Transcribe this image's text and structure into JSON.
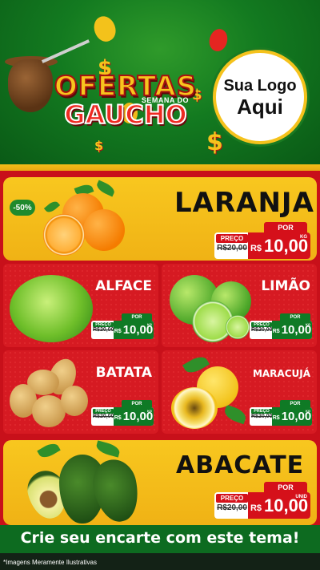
{
  "header": {
    "title_line1": "OFERTAS",
    "title_small": "SEMANA DO",
    "title_line2": "GAUCHO",
    "logo_line1": "Sua Logo",
    "logo_line2": "Aqui"
  },
  "featured_top": {
    "discount": "-50%",
    "name": "LARANJA",
    "por_label": "POR",
    "preco_label": "PREÇO",
    "old_price": "R$20,00",
    "currency": "R$",
    "price": "10,00",
    "unit": "KG"
  },
  "grid": [
    {
      "name": "ALFACE",
      "por_label": "POR",
      "preco_label": "PREÇO",
      "old_price": "R$20,00",
      "currency": "R$",
      "price": "10,00",
      "unit": "KG"
    },
    {
      "name": "LIMÃO",
      "por_label": "POR",
      "preco_label": "PREÇO",
      "old_price": "R$20,00",
      "currency": "R$",
      "price": "10,00",
      "unit": "KG"
    },
    {
      "name": "BATATA",
      "por_label": "POR",
      "preco_label": "PREÇO",
      "old_price": "R$20,00",
      "currency": "R$",
      "price": "10,00",
      "unit": "KG"
    },
    {
      "name": "MARACUJÁ",
      "por_label": "POR",
      "preco_label": "PREÇO",
      "old_price": "R$20,00",
      "currency": "R$",
      "price": "10,00",
      "unit": "KG"
    }
  ],
  "featured_bottom": {
    "name": "ABACATE",
    "por_label": "POR",
    "preco_label": "PREÇO",
    "old_price": "R$20,00",
    "currency": "R$",
    "price": "10,00",
    "unit": "UNID"
  },
  "footer": {
    "cta": "Crie seu encarte com este tema!",
    "disclaimer": "*Imagens Meramente Ilustrativas"
  },
  "colors": {
    "green": "#0f7a25",
    "red": "#c8101a",
    "yellow": "#f8c71f"
  }
}
